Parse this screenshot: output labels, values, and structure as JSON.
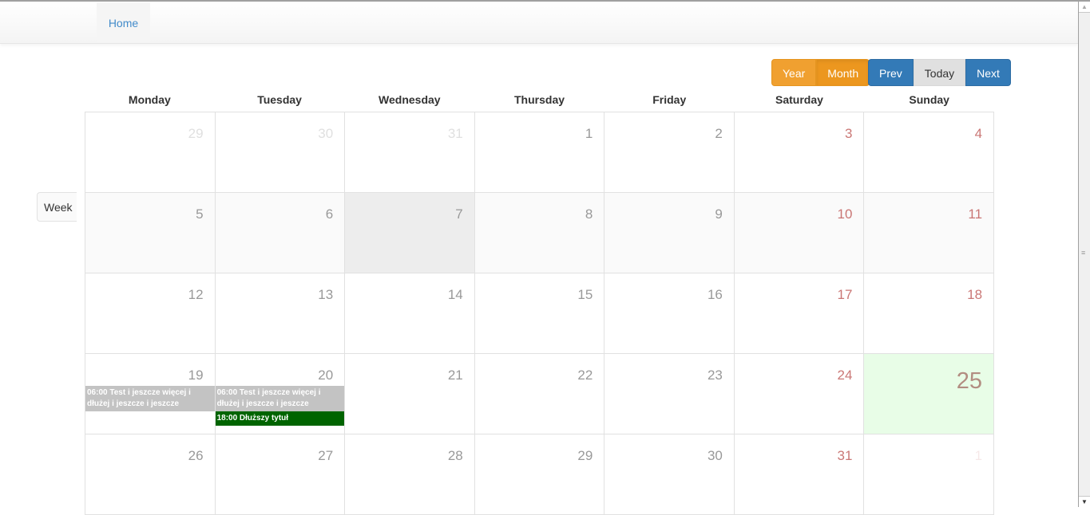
{
  "nav": {
    "home_label": "Home"
  },
  "toolbar": {
    "year_label": "Year",
    "month_label": "Month",
    "prev_label": "Prev",
    "today_label": "Today",
    "next_label": "Next"
  },
  "week_button_label": "Week",
  "calendar": {
    "weekdays": [
      "Monday",
      "Tuesday",
      "Wednesday",
      "Thursday",
      "Friday",
      "Saturday",
      "Sunday"
    ],
    "weeks": [
      [
        {
          "d": "29",
          "o": 1
        },
        {
          "d": "30",
          "o": 1
        },
        {
          "d": "31",
          "o": 1
        },
        {
          "d": "1"
        },
        {
          "d": "2"
        },
        {
          "d": "3",
          "w": 1
        },
        {
          "d": "4",
          "w": 1
        }
      ],
      [
        {
          "d": "5"
        },
        {
          "d": "6"
        },
        {
          "d": "7",
          "h": 1
        },
        {
          "d": "8"
        },
        {
          "d": "9"
        },
        {
          "d": "10",
          "w": 1
        },
        {
          "d": "11",
          "w": 1
        }
      ],
      [
        {
          "d": "12"
        },
        {
          "d": "13"
        },
        {
          "d": "14"
        },
        {
          "d": "15"
        },
        {
          "d": "16"
        },
        {
          "d": "17",
          "w": 1
        },
        {
          "d": "18",
          "w": 1
        }
      ],
      [
        {
          "d": "19",
          "ev": [
            {
              "t": "06:00 Test i jeszcze więcej i dłużej i jeszcze i jeszcze",
              "c": "gray"
            }
          ]
        },
        {
          "d": "20",
          "ev": [
            {
              "t": "06:00 Test i jeszcze więcej i dłużej i jeszcze i jeszcze",
              "c": "gray"
            },
            {
              "t": "18:00 Dłuższy tytuł",
              "c": "green"
            }
          ]
        },
        {
          "d": "21"
        },
        {
          "d": "22"
        },
        {
          "d": "23"
        },
        {
          "d": "24",
          "w": 1
        },
        {
          "d": "25",
          "w": 1,
          "today": 1
        }
      ],
      [
        {
          "d": "26"
        },
        {
          "d": "27"
        },
        {
          "d": "28"
        },
        {
          "d": "29"
        },
        {
          "d": "30"
        },
        {
          "d": "31",
          "w": 1
        },
        {
          "d": "1",
          "w": 1,
          "o": 1
        }
      ]
    ],
    "highlighted_week_index": 1
  },
  "colors": {
    "warning": "#f0a030",
    "primary": "#337ab7",
    "today_bg": "#e8fde7",
    "event_gray": "#c3c3c3",
    "event_green": "#006400",
    "weekend_text": "#b94a48"
  }
}
